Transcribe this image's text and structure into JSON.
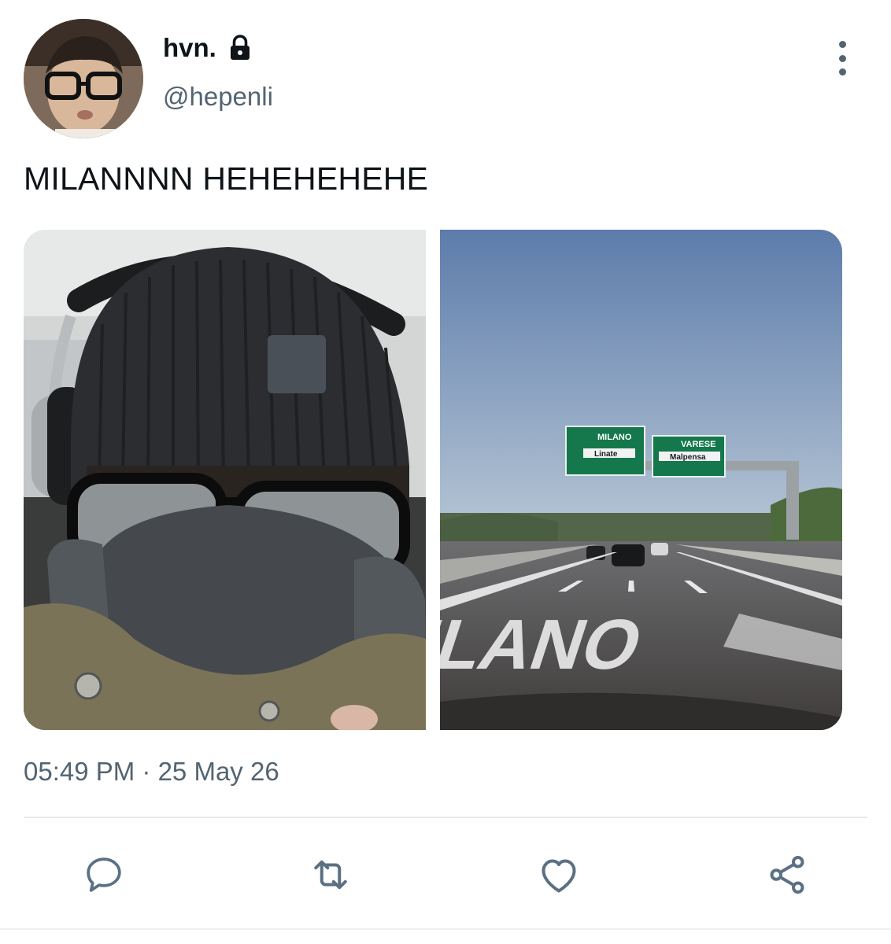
{
  "tweet": {
    "author": {
      "display_name": "hvn.",
      "handle": "@hepenli",
      "protected_icon": "lock-icon"
    },
    "text": "MILANNNN HEHEHEHEHE",
    "media": [
      {
        "kind": "photo",
        "subject": "selfie"
      },
      {
        "kind": "photo",
        "subject": "highway"
      }
    ],
    "road_signs": {
      "sign1_city": "MILANO",
      "sign1_dest": "Linate",
      "sign2_city": "VARESE",
      "sign2_dest": "Malpensa",
      "road_marking": "MILANO"
    },
    "timestamp": "05:49 PM · 25 May 26",
    "actions": {
      "reply": "reply-icon",
      "retweet": "retweet-icon",
      "like": "heart-icon",
      "share": "share-icon"
    }
  },
  "colors": {
    "text_primary": "#0f1419",
    "text_secondary": "#536471",
    "icon": "#5b7083"
  }
}
